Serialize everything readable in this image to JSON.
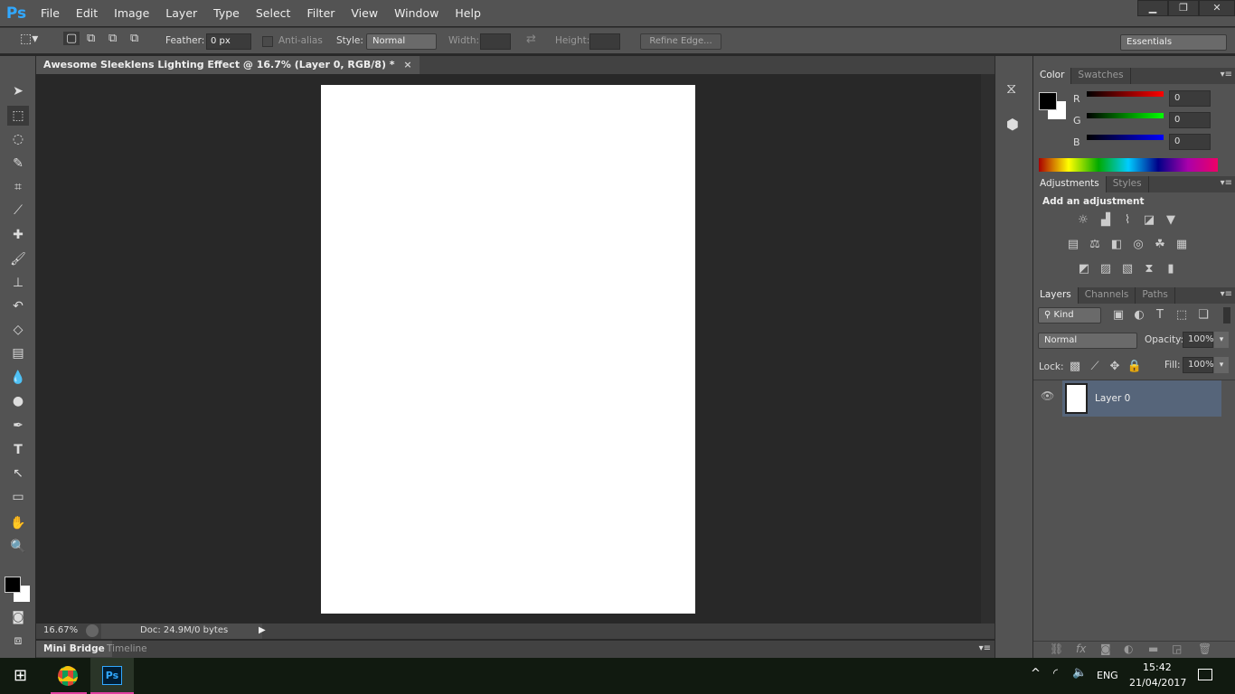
{
  "app": {
    "logo": "Ps",
    "menu": [
      "File",
      "Edit",
      "Image",
      "Layer",
      "Type",
      "Select",
      "Filter",
      "View",
      "Window",
      "Help"
    ]
  },
  "window_controls": [
    "minimize",
    "restore",
    "close"
  ],
  "options": {
    "feather_label": "Feather:",
    "feather_value": "0 px",
    "antialias_label": "Anti-alias",
    "style_label": "Style:",
    "style_value": "Normal",
    "width_label": "Width:",
    "height_label": "Height:",
    "refine_edge": "Refine Edge...",
    "workspace": "Essentials"
  },
  "document": {
    "tab_title": "Awesome Sleeklens Lighting Effect @ 16.7% (Layer 0, RGB/8) *",
    "close": "×"
  },
  "status": {
    "zoom": "16.67%",
    "doc": "Doc: 24.9M/0 bytes"
  },
  "bottom_tabs": [
    "Mini Bridge",
    "Timeline"
  ],
  "tools": [
    "move",
    "rectangular-marquee",
    "lasso",
    "quick-selection",
    "crop",
    "eyedropper",
    "spot-healing",
    "brush",
    "clone-stamp",
    "history-brush",
    "eraser",
    "gradient",
    "blur",
    "dodge",
    "pen",
    "type",
    "path-selection",
    "rectangle",
    "hand",
    "zoom"
  ],
  "color_panel": {
    "tabs": [
      "Color",
      "Swatches"
    ],
    "channels": [
      {
        "label": "R",
        "value": "0",
        "color": "#ff0000"
      },
      {
        "label": "G",
        "value": "0",
        "color": "#00ff00"
      },
      {
        "label": "B",
        "value": "0",
        "color": "#0000ff"
      }
    ],
    "foreground": "#000000",
    "background": "#ffffff"
  },
  "adjustments_panel": {
    "tabs": [
      "Adjustments",
      "Styles"
    ],
    "heading": "Add an adjustment"
  },
  "layers_panel": {
    "tabs": [
      "Layers",
      "Channels",
      "Paths"
    ],
    "filter": "Kind",
    "blend_mode": "Normal",
    "opacity_label": "Opacity:",
    "opacity": "100%",
    "lock_label": "Lock:",
    "fill_label": "Fill:",
    "fill": "100%",
    "layers": [
      {
        "name": "Layer 0",
        "visible": true,
        "selected": true
      }
    ]
  },
  "taskbar": {
    "language": "ENG",
    "time": "15:42",
    "date": "21/04/2017"
  }
}
